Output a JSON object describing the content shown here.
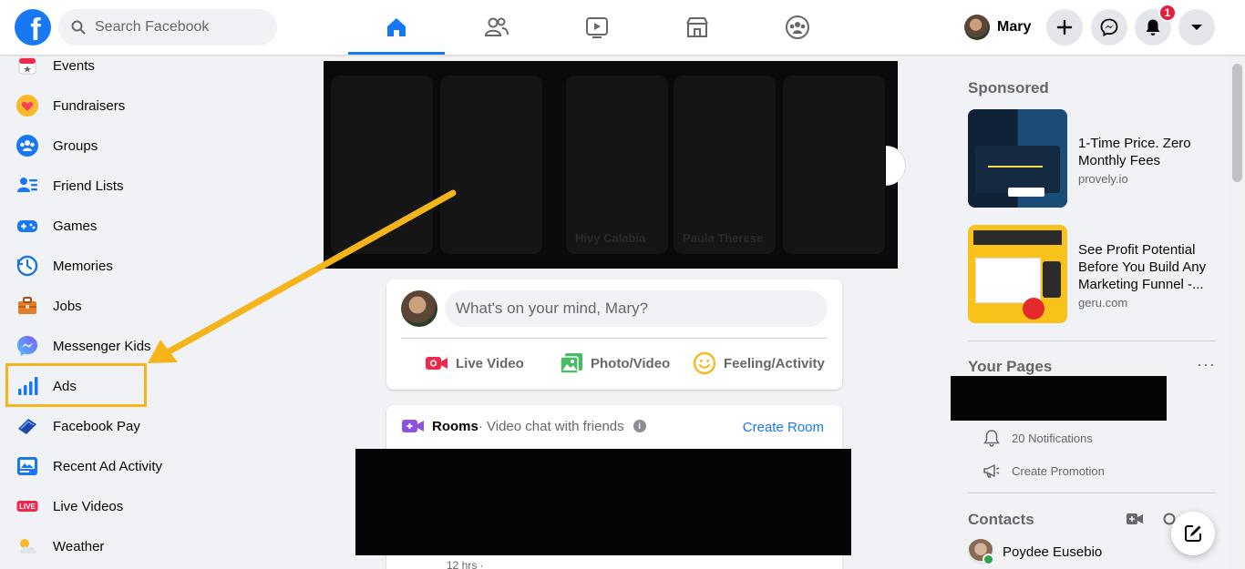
{
  "header": {
    "search_placeholder": "Search Facebook",
    "user_name": "Mary",
    "notification_count": "1",
    "tabs": [
      "home",
      "friends",
      "watch",
      "marketplace",
      "groups"
    ]
  },
  "sidebar": {
    "items": [
      {
        "label": "Events",
        "icon": "calendar-icon"
      },
      {
        "label": "Fundraisers",
        "icon": "heart-icon"
      },
      {
        "label": "Groups",
        "icon": "groups-icon"
      },
      {
        "label": "Friend Lists",
        "icon": "friend-lists-icon"
      },
      {
        "label": "Games",
        "icon": "gamepad-icon"
      },
      {
        "label": "Memories",
        "icon": "clock-icon"
      },
      {
        "label": "Jobs",
        "icon": "briefcase-icon"
      },
      {
        "label": "Messenger Kids",
        "icon": "messenger-kids-icon"
      },
      {
        "label": "Ads",
        "icon": "bar-chart-icon"
      },
      {
        "label": "Facebook Pay",
        "icon": "pay-icon"
      },
      {
        "label": "Recent Ad Activity",
        "icon": "ad-activity-icon"
      },
      {
        "label": "Live Videos",
        "icon": "live-icon"
      },
      {
        "label": "Weather",
        "icon": "weather-icon"
      }
    ]
  },
  "stories": {
    "names": [
      "",
      "",
      "Hivy Calabia",
      "Paula Therese",
      ""
    ]
  },
  "composer": {
    "placeholder": "What's on your mind, Mary?",
    "actions": [
      "Live Video",
      "Photo/Video",
      "Feeling/Activity"
    ]
  },
  "rooms": {
    "title": "Rooms",
    "subtitle": " · Video chat with friends",
    "create_label": "Create Room",
    "post_time": "12 hrs · "
  },
  "right": {
    "sponsored_title": "Sponsored",
    "ads": [
      {
        "title": "1-Time Price. Zero Monthly Fees",
        "domain": "provely.io"
      },
      {
        "title": "See Profit Potential Before You Build Any Marketing Funnel -...",
        "domain": "geru.com"
      }
    ],
    "your_pages_title": "Your Pages",
    "page_notifications": "20 Notifications",
    "page_promotion": "Create Promotion",
    "contacts_title": "Contacts",
    "contacts": [
      {
        "name": "Poydee Eusebio",
        "online": true
      }
    ]
  },
  "annotation": {
    "color": "#f4b41a",
    "highlighted_item": "Ads"
  },
  "colors": {
    "brand": "#1877f2",
    "background": "#f0f2f5",
    "notification": "#e41e3f"
  }
}
